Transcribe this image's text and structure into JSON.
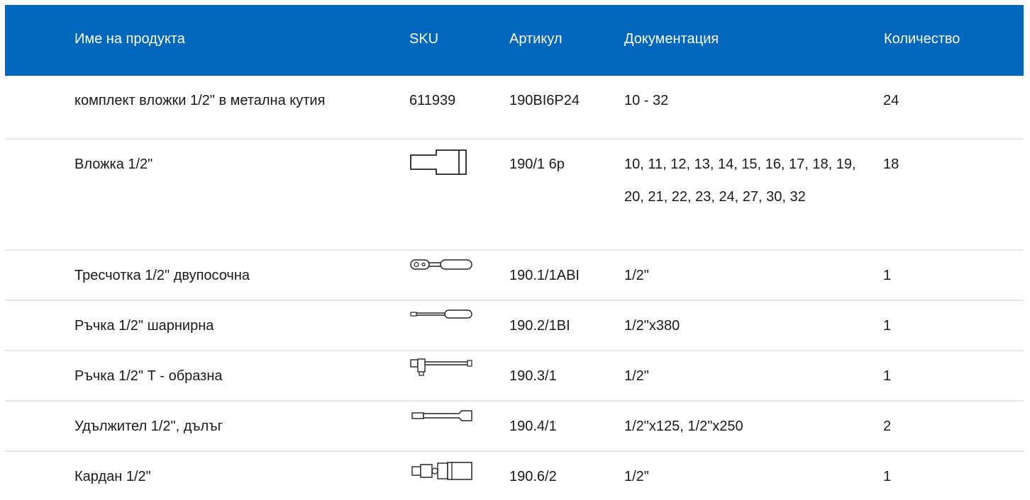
{
  "table": {
    "headers": {
      "name": "Име на продукта",
      "sku": "SKU",
      "article": "Артикул",
      "documentation": "Документация",
      "quantity": "Количество"
    },
    "rows": [
      {
        "name": "комплект вложки 1/2\" в метална кутия",
        "sku": "611939",
        "article": "190BI6P24",
        "documentation": "10 - 32",
        "quantity": "24"
      },
      {
        "name": "Вложка 1/2\"",
        "sku_image": "socket-icon",
        "article": "190/1 6p",
        "documentation": "10, 11, 12, 13, 14, 15, 16, 17, 18, 19, 20, 21, 22, 23, 24, 27, 30, 32",
        "quantity": "18"
      },
      {
        "name": "Тресчотка 1/2\" двупосочна",
        "sku_image": "ratchet-icon",
        "article": "190.1/1ABI",
        "documentation": "1/2\"",
        "quantity": "1"
      },
      {
        "name": "Ръчка 1/2\" шарнирна",
        "sku_image": "hinged-handle-icon",
        "article": "190.2/1BI",
        "documentation": "1/2\"x380",
        "quantity": "1"
      },
      {
        "name": "Ръчка 1/2\" Т - образна",
        "sku_image": "t-handle-icon",
        "article": "190.3/1",
        "documentation": "1/2\"",
        "quantity": "1"
      },
      {
        "name": "Удължител 1/2\", дълъг",
        "sku_image": "extension-bar-icon",
        "article": "190.4/1",
        "documentation": "1/2\"x125, 1/2\"x250",
        "quantity": "2"
      },
      {
        "name": "Кардан 1/2\"",
        "sku_image": "universal-joint-icon",
        "article": "190.6/2",
        "documentation": "1/2\"",
        "quantity": "1"
      }
    ]
  },
  "colors": {
    "header_background": "#0067bd",
    "header_text": "#ffffff",
    "row_divider": "#e6e6e6",
    "body_text": "#1a1a1a"
  }
}
